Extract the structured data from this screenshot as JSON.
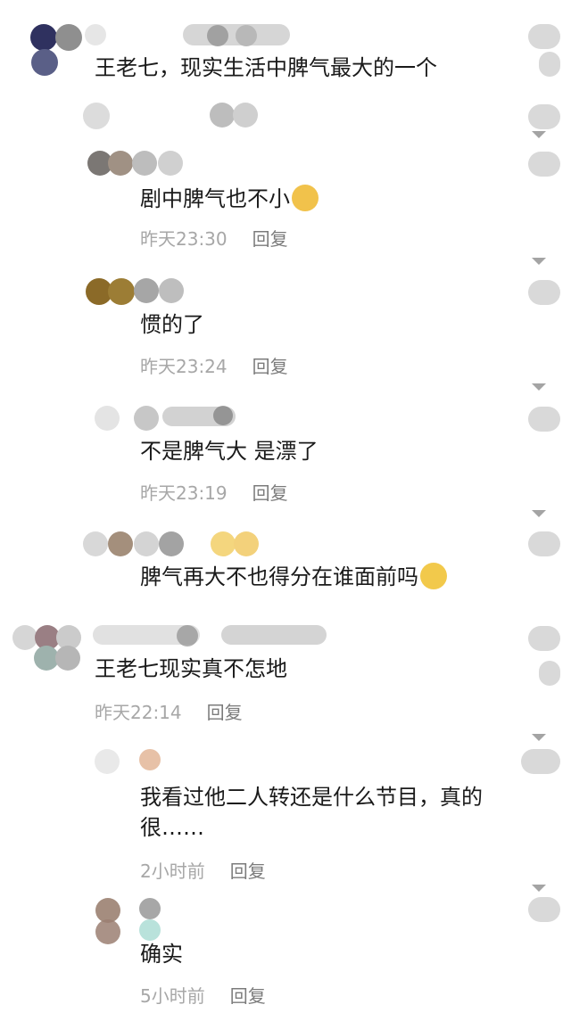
{
  "comments": [
    {
      "text": "王老七，现实生活中脾气最大的一个"
    },
    {
      "text": "剧中脾气也不小",
      "emoji": "smirk-face",
      "time": "昨天23:30",
      "reply": "回复"
    },
    {
      "text": "惯的了",
      "time": "昨天23:24",
      "reply": "回复"
    },
    {
      "text": "不是脾气大 是漂了",
      "time": "昨天23:19",
      "reply": "回复"
    },
    {
      "text": "脾气再大不也得分在谁面前吗",
      "emoji": "laughing-tears-face"
    },
    {
      "text": "王老七现实真不怎地",
      "time": "昨天22:14",
      "reply": "回复"
    },
    {
      "text": "我看过他二人转还是什么节目，真的很……",
      "time": "2小时前",
      "reply": "回复"
    },
    {
      "text": "确实",
      "time": "5小时前",
      "reply": "回复"
    }
  ],
  "colors": {
    "text": "#1a1a1a",
    "meta": "#a7a7a7",
    "reply": "#7b7b7b",
    "blur": "#cfcfcf"
  }
}
